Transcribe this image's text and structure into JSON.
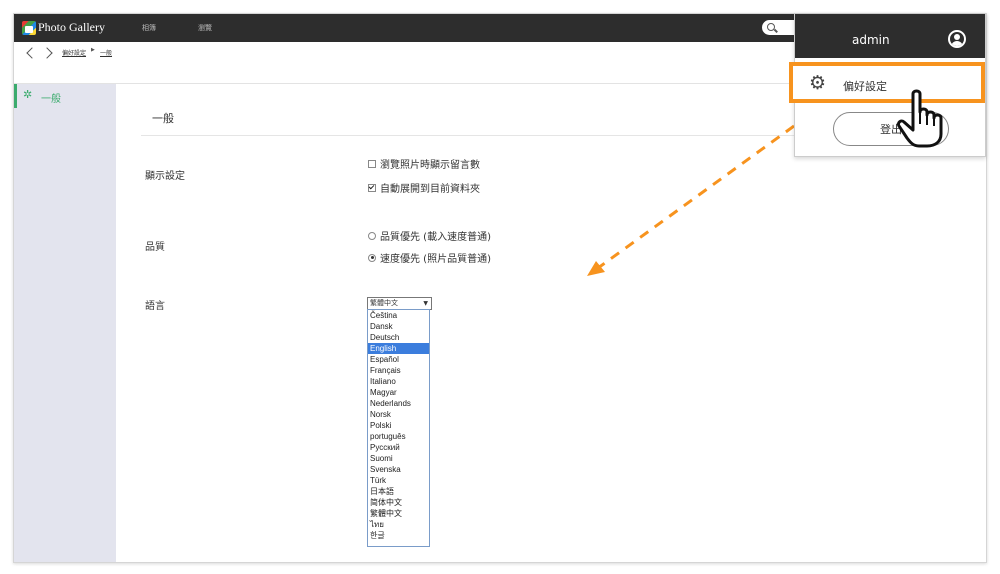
{
  "app": {
    "title": "Photo Gallery"
  },
  "nav": {
    "items": [
      "相簿",
      "瀏覽"
    ]
  },
  "breadcrumb": {
    "items": [
      "偏好設定",
      "一般"
    ]
  },
  "sidebar": {
    "items": [
      {
        "label": "一般",
        "icon": "gear-icon",
        "active": true
      }
    ]
  },
  "main": {
    "section_title": "一般",
    "display_settings": {
      "label": "顯示設定",
      "options": [
        {
          "label": "瀏覽照片時顯示留言數",
          "checked": false
        },
        {
          "label": "自動展開到目前資料夾",
          "checked": true
        }
      ]
    },
    "quality": {
      "label": "品質",
      "options": [
        {
          "label": "品質優先 (載入速度普通)",
          "checked": false
        },
        {
          "label": "速度優先 (照片品質普通)",
          "checked": true
        }
      ]
    },
    "language": {
      "label": "語言",
      "selected": "繁體中文",
      "highlighted": "English",
      "options": [
        "Čeština",
        "Dansk",
        "Deutsch",
        "English",
        "Español",
        "Français",
        "Italiano",
        "Magyar",
        "Nederlands",
        "Norsk",
        "Polski",
        "português",
        "Русский",
        "Suomi",
        "Svenska",
        "Türk",
        "日本語",
        "简体中文",
        "繁體中文",
        "ไทย",
        "한글"
      ]
    }
  },
  "user_menu": {
    "username": "admin",
    "preferences_label": "偏好設定",
    "logout_label": "登出"
  },
  "colors": {
    "accent_green": "#3bab6d",
    "highlight_orange": "#f7931e",
    "topbar": "#2d2d2d",
    "selection_blue": "#3b7ddd"
  }
}
